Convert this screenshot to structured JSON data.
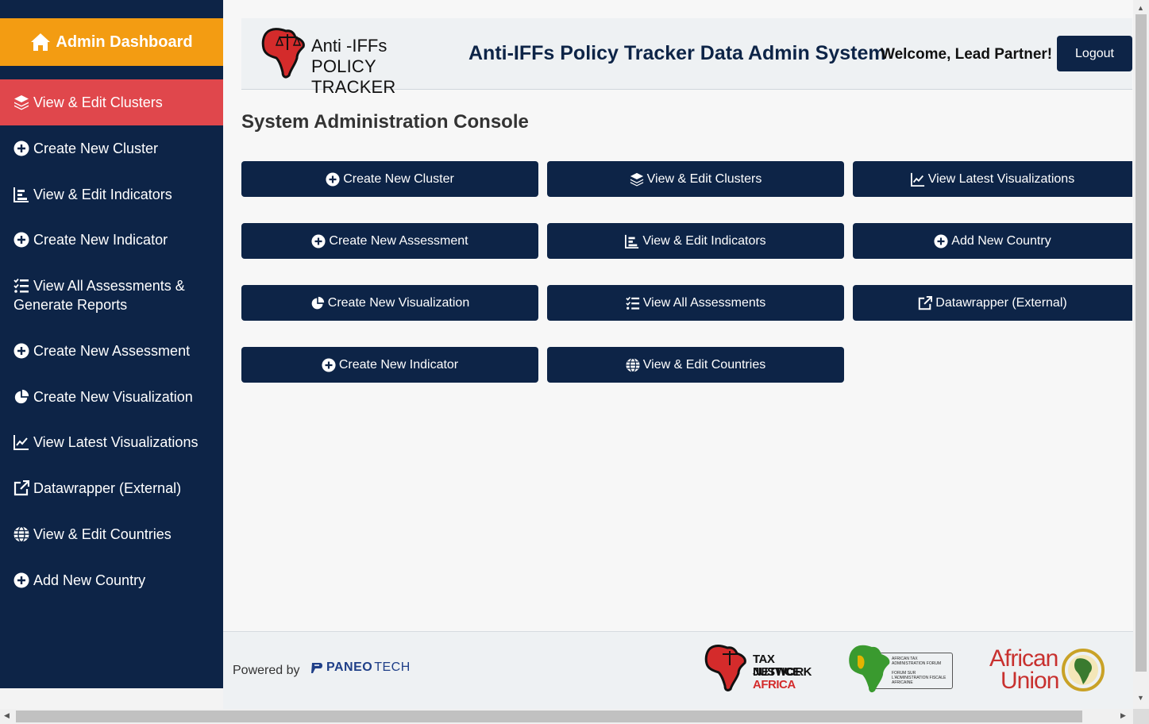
{
  "sidebar": {
    "header": "Admin Dashboard",
    "items": [
      {
        "label": "View & Edit Clusters",
        "icon": "layers-icon",
        "active": true
      },
      {
        "label": "Create New Cluster",
        "icon": "plus-circle-icon"
      },
      {
        "label": "View & Edit Indicators",
        "icon": "bar-chart-icon"
      },
      {
        "label": "Create New Indicator",
        "icon": "plus-circle-icon"
      },
      {
        "label": "View All Assessments &",
        "label2": "Generate Reports",
        "icon": "list-check-icon"
      },
      {
        "label": "Create New Assessment",
        "icon": "plus-circle-icon"
      },
      {
        "label": "Create New Visualization",
        "icon": "pie-chart-icon"
      },
      {
        "label": "View Latest Visualizations",
        "icon": "line-chart-icon"
      },
      {
        "label": "Datawrapper (External)",
        "icon": "external-link-icon"
      },
      {
        "label": "View & Edit Countries",
        "icon": "globe-icon"
      },
      {
        "label": "Add New Country",
        "icon": "plus-circle-icon"
      }
    ]
  },
  "header": {
    "logo_line1": "Anti -IFFs",
    "logo_line2": "POLICY TRACKER",
    "title": "Anti-IFFs Policy Tracker Data Admin System",
    "welcome": "Welcome, Lead Partner!",
    "logout": "Logout"
  },
  "main": {
    "title": "System Administration Console",
    "buttons": [
      {
        "label": "Create New Cluster",
        "icon": "plus-circle-icon"
      },
      {
        "label": "View & Edit Clusters",
        "icon": "layers-icon"
      },
      {
        "label": "View Latest Visualizations",
        "icon": "line-chart-icon"
      },
      {
        "label": "Create New Assessment",
        "icon": "plus-circle-icon"
      },
      {
        "label": "View & Edit Indicators",
        "icon": "bar-chart-icon"
      },
      {
        "label": "Add New Country",
        "icon": "plus-circle-icon"
      },
      {
        "label": "Create New Visualization",
        "icon": "pie-chart-icon"
      },
      {
        "label": "View All Assessments",
        "icon": "list-check-icon"
      },
      {
        "label": "Datawrapper (External)",
        "icon": "external-link-icon"
      },
      {
        "label": "Create New Indicator",
        "icon": "plus-circle-icon"
      },
      {
        "label": "View & Edit Countries",
        "icon": "globe-icon"
      }
    ]
  },
  "footer": {
    "powered_by": "Powered by",
    "paneo": "PANEO",
    "tech": "TECH",
    "tjn1": "TAX JUSTICE",
    "tjn2": "NETWORK",
    "tjn3": "AFRICA",
    "ataf1": "AFRICAN TAX ADMINISTRATION FORUM",
    "ataf2": "FORUM SUR L'ADMINISTRATION FISCALE AFRICAINE",
    "au1": "African",
    "au2": "Union"
  },
  "colors": {
    "navy": "#0d2447",
    "orange": "#f39c12",
    "active_red": "#e0474c"
  }
}
